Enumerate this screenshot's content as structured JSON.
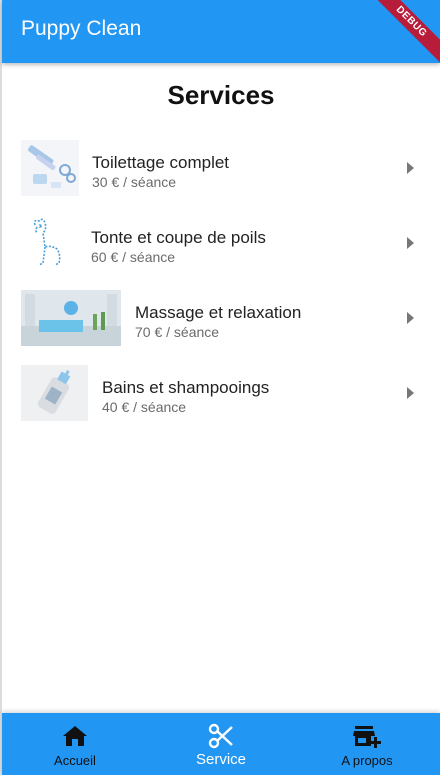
{
  "app": {
    "title": "Puppy Clean",
    "debug_banner": "DEBUG"
  },
  "page": {
    "title": "Services"
  },
  "services": [
    {
      "name": "Toilettage complet",
      "price": "30 € / séance",
      "icon": "grooming-tools-image"
    },
    {
      "name": "Tonte et coupe de poils",
      "price": "60 € / séance",
      "icon": "dog-outline-image"
    },
    {
      "name": "Massage et relaxation",
      "price": "70 € / séance",
      "icon": "spa-room-image"
    },
    {
      "name": "Bains et shampooings",
      "price": "40 € / séance",
      "icon": "shampoo-bottle-image"
    }
  ],
  "bottom_nav": {
    "items": [
      {
        "label": "Accueil",
        "icon": "home-icon"
      },
      {
        "label": "Service",
        "icon": "scissors-icon",
        "active": true
      },
      {
        "label": "A propos",
        "icon": "store-add-icon"
      }
    ],
    "color": "#2196f3"
  },
  "colors": {
    "primary": "#2196f3",
    "debug": "#b71c3a"
  }
}
